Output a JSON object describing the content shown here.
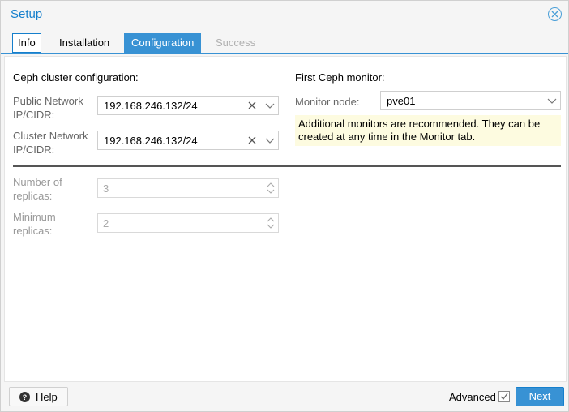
{
  "window": {
    "title": "Setup"
  },
  "tabs": [
    {
      "label": "Info"
    },
    {
      "label": "Installation"
    },
    {
      "label": "Configuration"
    },
    {
      "label": "Success"
    }
  ],
  "ceph_config": {
    "title": "Ceph cluster configuration:",
    "public_network": {
      "label_line1": "Public Network",
      "label_line2": "IP/CIDR:",
      "value": "192.168.246.132/24"
    },
    "cluster_network": {
      "label_line1": "Cluster Network",
      "label_line2": "IP/CIDR:",
      "value": "192.168.246.132/24"
    }
  },
  "first_monitor": {
    "title": "First Ceph monitor:",
    "monitor_node": {
      "label": "Monitor node:",
      "value": "pve01"
    },
    "note_line1": "Additional monitors are recommended. They can be",
    "note_line2": "created at any time in the Monitor tab."
  },
  "replicas": {
    "number": {
      "label_line1": "Number of",
      "label_line2": "replicas:",
      "value": "3"
    },
    "minimum": {
      "label_line1": "Minimum",
      "label_line2": "replicas:",
      "value": "2"
    }
  },
  "footer": {
    "help_label": "Help",
    "advanced_label": "Advanced",
    "advanced_checked": true,
    "next_label": "Next"
  },
  "colors": {
    "accent": "#3892d4",
    "title": "#157fcc",
    "note_bg": "#fdfbe0"
  }
}
